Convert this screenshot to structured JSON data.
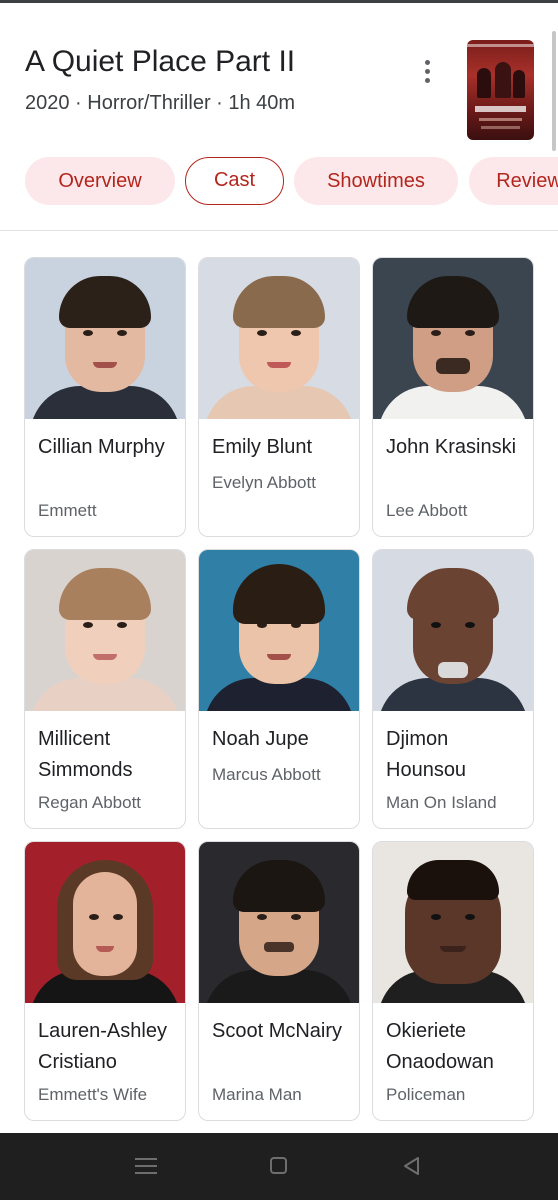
{
  "movie": {
    "title": "A Quiet Place Part II",
    "meta": "2020 · Horror/Thriller · 1h 40m"
  },
  "tabs": [
    {
      "label": "Overview",
      "active": false
    },
    {
      "label": "Cast",
      "active": true
    },
    {
      "label": "Showtimes",
      "active": false
    },
    {
      "label": "Reviews",
      "active": false
    }
  ],
  "cast": [
    {
      "name": "Cillian Murphy",
      "role": "Emmett"
    },
    {
      "name": "Emily Blunt",
      "role": "Evelyn Abbott"
    },
    {
      "name": "John Krasinski",
      "role": "Lee Abbott"
    },
    {
      "name": "Millicent Simmonds",
      "role": "Regan Abbott"
    },
    {
      "name": "Noah Jupe",
      "role": "Marcus Abbott"
    },
    {
      "name": "Djimon Hounsou",
      "role": "Man On Island"
    },
    {
      "name": "Lauren-Ashley Cristiano",
      "role": "Emmett's Wife"
    },
    {
      "name": "Scoot McNairy",
      "role": "Marina Man"
    },
    {
      "name": "Okieriete Onaodowan",
      "role": "Policeman"
    }
  ],
  "icons": {
    "more": "more-vert-icon",
    "nav_menu": "recents-icon",
    "nav_home": "home-icon",
    "nav_back": "back-icon"
  },
  "colors": {
    "accent": "#b3261e",
    "chip_bg": "#fce8ea",
    "navbar": "#1f1f1f"
  }
}
